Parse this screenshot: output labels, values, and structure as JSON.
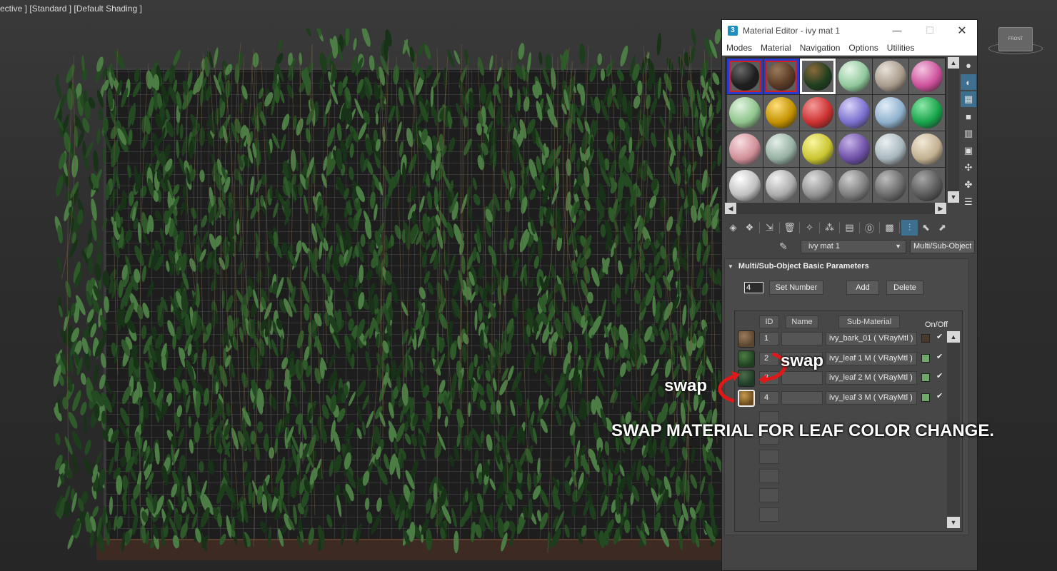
{
  "viewport": {
    "label": "ective ] [Standard ] [Default Shading ]",
    "viewcube_label": "FRONT"
  },
  "window": {
    "title": "Material Editor - ivy mat 1",
    "app_icon": "3ds-max-icon",
    "controls": {
      "minimize": "—",
      "maximize": "☐",
      "close": "✕"
    }
  },
  "menu": [
    "Modes",
    "Material",
    "Navigation",
    "Options",
    "Utilities"
  ],
  "sample_slots": [
    {
      "color": "#1e1e1e",
      "hl": "#6a6a6a",
      "corners": true
    },
    {
      "color": "#5a3a26",
      "hl": "#9a7a5a",
      "corners": true
    },
    {
      "color": "#1f3f1f",
      "hl": "#8a6a3a",
      "corners": true,
      "active": true
    },
    {
      "color": "#8fc89a",
      "hl": "#e6f7ea"
    },
    {
      "color": "#a79a8a",
      "hl": "#e8e2da"
    },
    {
      "color": "#cc4f9a",
      "hl": "#f5c6e2"
    },
    {
      "color": "#8ec48c",
      "hl": "#e2f4e0"
    },
    {
      "color": "#c39000",
      "hl": "#ffe07a"
    },
    {
      "color": "#cc3030",
      "hl": "#f59a9a"
    },
    {
      "color": "#7a6fcf",
      "hl": "#d9d4f8"
    },
    {
      "color": "#8fb0cc",
      "hl": "#e2eef8"
    },
    {
      "color": "#17a44a",
      "hl": "#8ee8aa"
    },
    {
      "color": "#d08f98",
      "hl": "#f8dde0"
    },
    {
      "color": "#96b0a2",
      "hl": "#e4eee8"
    },
    {
      "color": "#c9c530",
      "hl": "#fbf7a0"
    },
    {
      "color": "#6d4fa6",
      "hl": "#c7b4ea"
    },
    {
      "color": "#a7b6bc",
      "hl": "#eaf0f2"
    },
    {
      "color": "#c2b090",
      "hl": "#f2ead8"
    },
    {
      "color": "#bfbfbf",
      "hl": "#ffffff"
    },
    {
      "color": "#aaaaaa",
      "hl": "#f2f2f2"
    },
    {
      "color": "#909090",
      "hl": "#dedede"
    },
    {
      "color": "#7c7c7c",
      "hl": "#cfcfcf"
    },
    {
      "color": "#6a6a6a",
      "hl": "#bdbdbd"
    },
    {
      "color": "#595959",
      "hl": "#a6a6a6"
    }
  ],
  "side_tools": [
    "sphere-sample-icon",
    "backlight-icon",
    "checker-background-icon",
    "sample-uv-icon",
    "video-color-check-icon",
    "make-preview-icon",
    "options-icon",
    "select-by-material-icon",
    "material-navigator-icon"
  ],
  "bottom_tools": [
    "get-material-icon",
    "put-to-scene-icon",
    "assign-to-selection-icon",
    "reset-map-icon",
    "copy-material-icon",
    "make-unique-icon",
    "put-to-library-icon",
    "material-id-channel-icon",
    "show-shaded-icon",
    "show-end-result-icon",
    "go-to-parent-icon",
    "go-forward-icon"
  ],
  "material": {
    "name": "ivy mat 1",
    "type": "Multi/Sub-Object"
  },
  "rollout": {
    "title": "Multi/Sub-Object Basic Parameters",
    "count": "4",
    "set_number": "Set Number",
    "add": "Add",
    "delete": "Delete",
    "headers": {
      "id": "ID",
      "name": "Name",
      "sub_material": "Sub-Material",
      "on_off": "On/Off"
    },
    "check": "✔",
    "rows": [
      {
        "id": "1",
        "sub": "ivy_bark_01 ( VRayMtl )",
        "color": "#4a3a2a",
        "thumb": "#5a4530"
      },
      {
        "id": "2",
        "sub": "ivy_leaf 1 M ( VRayMtl )",
        "color": "#6fa86a",
        "thumb": "#244a24"
      },
      {
        "id": "3",
        "sub": "ivy_leaf 2 M ( VRayMtl )",
        "color": "#6fa86a",
        "thumb": "#24442a"
      },
      {
        "id": "4",
        "sub": "ivy_leaf 3 M ( VRayMtl )",
        "color": "#6fa86a",
        "thumb": "#8a6a2a"
      }
    ]
  },
  "annotations": {
    "swap_left": "swap",
    "swap_right": "swap",
    "caption": "SWAP MATERIAL FOR LEAF COLOR CHANGE."
  },
  "colors": {
    "leaf_dark": "#1e3d1c",
    "leaf_mid": "#2f5a2a",
    "leaf_light": "#4c7d44",
    "arrow_red": "#e01818"
  }
}
